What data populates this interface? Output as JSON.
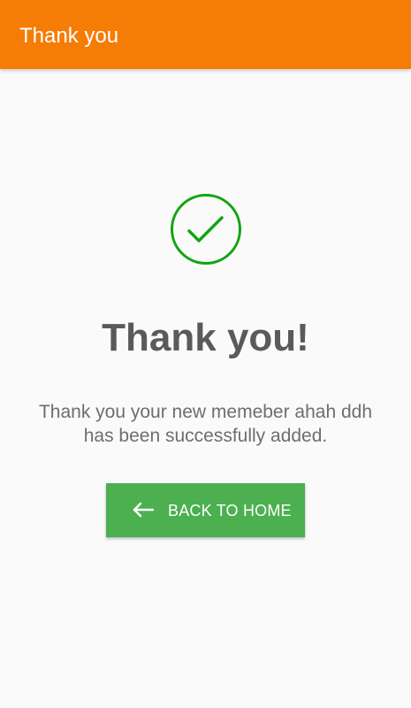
{
  "toolbar": {
    "title": "Thank you",
    "background_color": "#f57c05"
  },
  "success": {
    "icon": "check-circle-icon",
    "icon_color": "#12a512",
    "heading": "Thank you!",
    "message": "Thank you your new memeber ahah ddh has been successfully added."
  },
  "actions": {
    "back_home": {
      "label": "BACK TO HOME",
      "icon": "arrow-left-icon",
      "background_color": "#4caf50"
    }
  }
}
